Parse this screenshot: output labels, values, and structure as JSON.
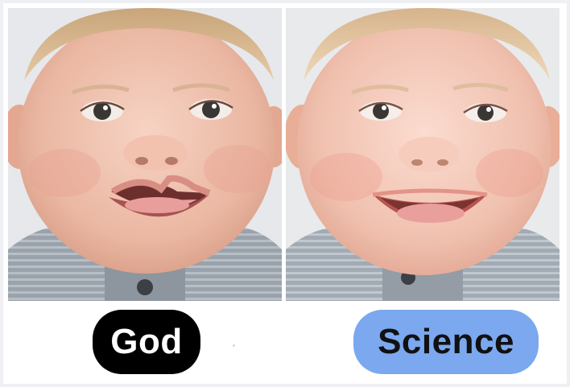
{
  "panels": [
    {
      "caption": "God",
      "caption_bg": "#000000",
      "caption_color": "#ffffff",
      "image": "baby-cleft-lip-photo"
    },
    {
      "caption": "Science",
      "caption_bg": "#7ba8ef",
      "caption_color": "#111111",
      "image": "baby-repaired-lip-photo"
    }
  ]
}
